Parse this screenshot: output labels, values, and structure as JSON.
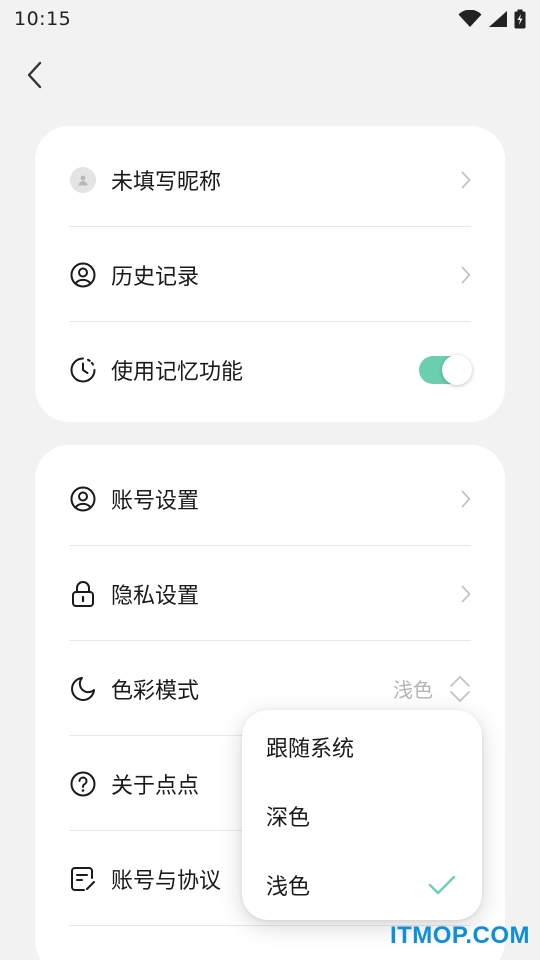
{
  "status_bar": {
    "time": "10:15"
  },
  "colors": {
    "accent": "#6ccfb0",
    "watermark": "#0f8fd8"
  },
  "card1": {
    "items": [
      {
        "label": "未填写昵称",
        "icon": "avatar-icon"
      },
      {
        "label": "历史记录",
        "icon": "user-circle-icon"
      },
      {
        "label": "使用记忆功能",
        "icon": "memory-clock-icon",
        "toggle_on": true
      }
    ]
  },
  "card2": {
    "items": [
      {
        "label": "账号设置",
        "icon": "user-circle-icon"
      },
      {
        "label": "隐私设置",
        "icon": "lock-icon"
      },
      {
        "label": "色彩模式",
        "icon": "moon-icon",
        "value": "浅色"
      },
      {
        "label": "关于点点",
        "icon": "question-icon"
      },
      {
        "label": "账号与协议",
        "icon": "document-icon"
      }
    ]
  },
  "color_mode_menu": {
    "options": [
      {
        "label": "跟随系统"
      },
      {
        "label": "深色"
      },
      {
        "label": "浅色",
        "selected": true
      }
    ]
  },
  "watermark": "ITMOP.COM"
}
